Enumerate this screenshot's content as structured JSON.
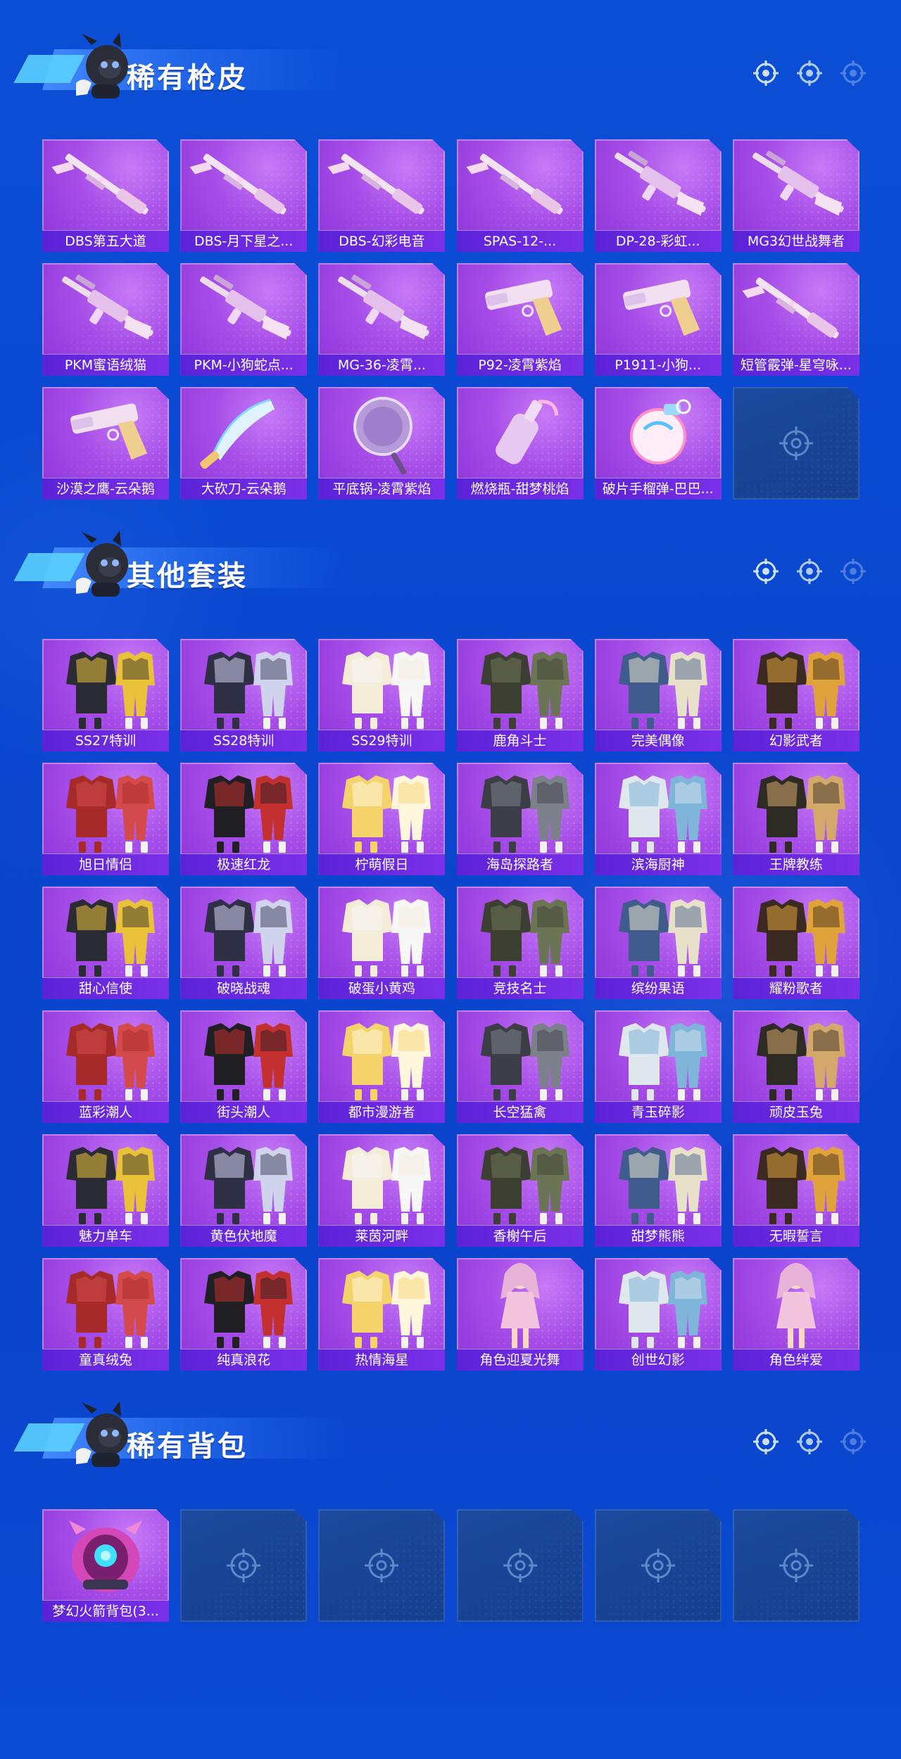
{
  "sections": [
    {
      "title": "稀有枪皮",
      "items": [
        {
          "label": "DBS第五大道",
          "icon": "shotgun-icon"
        },
        {
          "label": "DBS-月下星之...",
          "icon": "shotgun-icon"
        },
        {
          "label": "DBS-幻彩电音",
          "icon": "shotgun-icon"
        },
        {
          "label": "SPAS-12-...",
          "icon": "shotgun-icon"
        },
        {
          "label": "DP-28-彩虹...",
          "icon": "machine-gun-icon"
        },
        {
          "label": "MG3幻世战舞者",
          "icon": "machine-gun-icon"
        },
        {
          "label": "PKM蜜语绒猫",
          "icon": "machine-gun-icon"
        },
        {
          "label": "PKM-小狗蛇点...",
          "icon": "machine-gun-icon"
        },
        {
          "label": "MG-36-凌霄...",
          "icon": "machine-gun-icon"
        },
        {
          "label": "P92-凌霄紫焰",
          "icon": "pistol-icon"
        },
        {
          "label": "P1911-小狗...",
          "icon": "pistol-icon"
        },
        {
          "label": "短管霰弹-星穹咏...",
          "icon": "shotgun-icon"
        },
        {
          "label": "沙漠之鹰-云朵鹅",
          "icon": "pistol-icon"
        },
        {
          "label": "大砍刀-云朵鹅",
          "icon": "machete-icon"
        },
        {
          "label": "平底锅-凌霄紫焰",
          "icon": "pan-icon"
        },
        {
          "label": "燃烧瓶-甜梦桃焰",
          "icon": "molotov-icon"
        },
        {
          "label": "破片手榴弹-巴巴...",
          "icon": "grenade-icon"
        }
      ],
      "empty_slots": 1
    },
    {
      "title": "其他套装",
      "items": [
        {
          "label": "SS27特训",
          "icon": "outfit-icon"
        },
        {
          "label": "SS28特训",
          "icon": "outfit-icon"
        },
        {
          "label": "SS29特训",
          "icon": "outfit-icon"
        },
        {
          "label": "鹿角斗士",
          "icon": "outfit-icon"
        },
        {
          "label": "完美偶像",
          "icon": "outfit-icon"
        },
        {
          "label": "幻影武者",
          "icon": "outfit-icon"
        },
        {
          "label": "旭日情侣",
          "icon": "outfit-icon"
        },
        {
          "label": "极速红龙",
          "icon": "outfit-icon"
        },
        {
          "label": "柠萌假日",
          "icon": "outfit-icon"
        },
        {
          "label": "海岛探路者",
          "icon": "outfit-icon"
        },
        {
          "label": "滨海厨神",
          "icon": "outfit-icon"
        },
        {
          "label": "王牌教练",
          "icon": "outfit-icon"
        },
        {
          "label": "甜心信使",
          "icon": "outfit-icon"
        },
        {
          "label": "破晓战魂",
          "icon": "outfit-icon"
        },
        {
          "label": "破蛋小黄鸡",
          "icon": "outfit-icon"
        },
        {
          "label": "竞技名士",
          "icon": "outfit-icon"
        },
        {
          "label": "缤纷果语",
          "icon": "outfit-icon"
        },
        {
          "label": "耀粉歌者",
          "icon": "outfit-icon"
        },
        {
          "label": "蓝彩潮人",
          "icon": "outfit-icon"
        },
        {
          "label": "街头潮人",
          "icon": "outfit-icon"
        },
        {
          "label": "都市漫游者",
          "icon": "outfit-icon"
        },
        {
          "label": "长空猛禽",
          "icon": "outfit-icon"
        },
        {
          "label": "青玉碎影",
          "icon": "outfit-icon"
        },
        {
          "label": "顽皮玉兔",
          "icon": "outfit-icon"
        },
        {
          "label": "魅力单车",
          "icon": "outfit-icon"
        },
        {
          "label": "黄色伏地魔",
          "icon": "outfit-icon"
        },
        {
          "label": "莱茵河畔",
          "icon": "outfit-icon"
        },
        {
          "label": "香榭午后",
          "icon": "outfit-icon"
        },
        {
          "label": "甜梦熊熊",
          "icon": "outfit-icon"
        },
        {
          "label": "无暇誓言",
          "icon": "outfit-icon"
        },
        {
          "label": "童真绒兔",
          "icon": "outfit-icon"
        },
        {
          "label": "纯真浪花",
          "icon": "outfit-icon"
        },
        {
          "label": "热情海星",
          "icon": "outfit-icon"
        },
        {
          "label": "角色迎夏光舞",
          "icon": "character-icon"
        },
        {
          "label": "创世幻影",
          "icon": "outfit-icon"
        },
        {
          "label": "角色绊爱",
          "icon": "character-icon"
        }
      ],
      "empty_slots": 0
    },
    {
      "title": "稀有背包",
      "items": [
        {
          "label": "梦幻火箭背包(3...",
          "icon": "backpack-icon"
        }
      ],
      "empty_slots": 5
    }
  ],
  "colors": {
    "background": "#0a46cf",
    "card_purple": "#a64de8",
    "label_bar": "#5b22d8",
    "empty_slot": "#163f8e"
  }
}
